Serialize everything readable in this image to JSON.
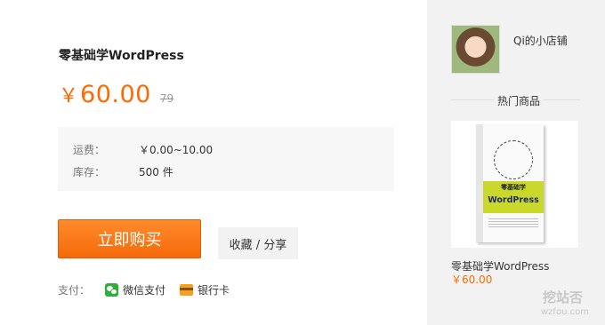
{
  "product": {
    "title": "零基础学WordPress",
    "currency": "￥",
    "price": "60.00",
    "original_price": "79"
  },
  "info": [
    {
      "label": "运费：",
      "value": "￥0.00~10.00"
    },
    {
      "label": "库存：",
      "value": "500 件"
    }
  ],
  "actions": {
    "buy_label": "立即购买",
    "favorite_share_label": "收藏 / 分享"
  },
  "payment": {
    "label": "支付：",
    "options": [
      {
        "label": "微信支付",
        "icon": "wechat-pay-icon"
      },
      {
        "label": "银行卡",
        "icon": "bank-card-icon"
      }
    ]
  },
  "sidebar": {
    "shop_name": "Qi的小店铺",
    "hot_label": "热门商品",
    "hot_product": {
      "name": "零基础学WordPress",
      "price": "￥60.00",
      "cover_subtitle": "零基础学",
      "cover_title": "WordPress"
    }
  },
  "watermark": {
    "line1": "挖站否",
    "line2": "wzfou.com"
  },
  "colors": {
    "accent": "#ff6a00",
    "sidebar_bg": "#f2f2f2",
    "info_bg": "#f7f7f7",
    "wechat": "#2bb03a",
    "bank_card": "#f3a21b"
  }
}
